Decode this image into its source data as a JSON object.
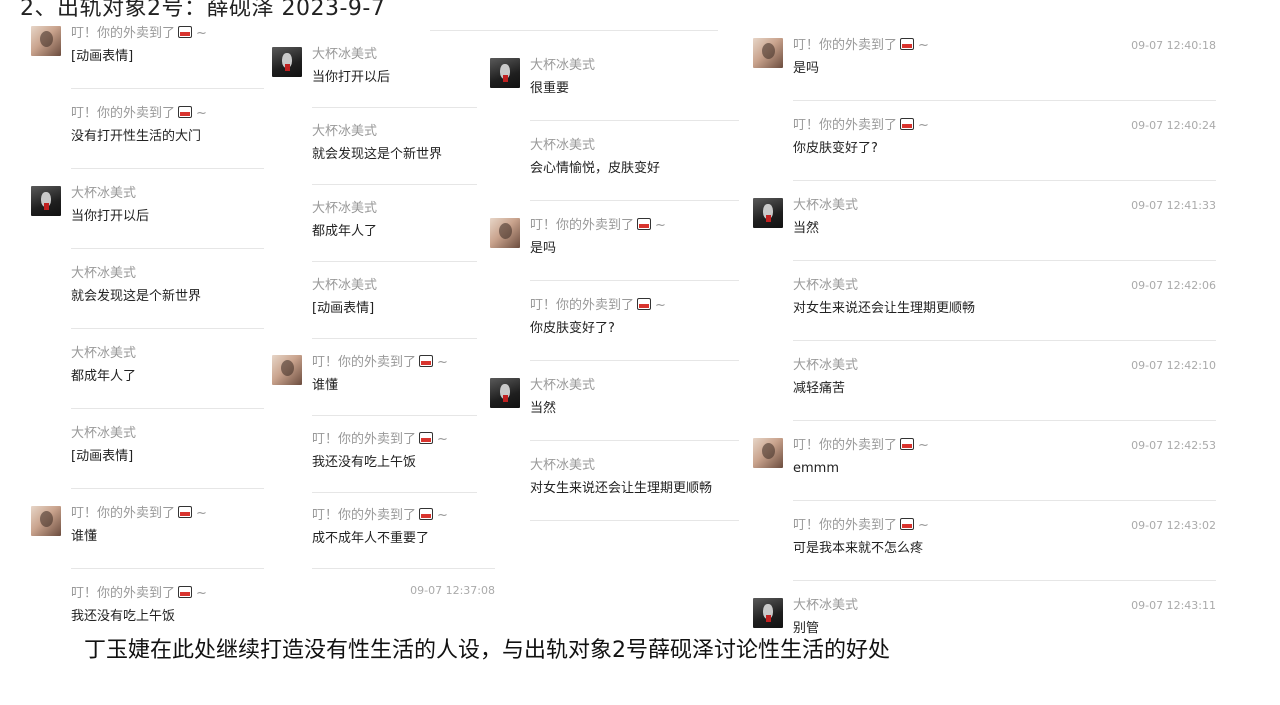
{
  "header": {
    "title": "2、出轨对象2号：薛砚泽 2023-9-7"
  },
  "footer": {
    "caption": "丁玉婕在此处继续打造没有性生活的人设，与出轨对象2号薛砚泽讨论性生活的好处"
  },
  "senders": {
    "woman": "叮！你的外卖到了",
    "man": "大杯冰美式"
  },
  "icons": {
    "takeout_box": "takeout-box-icon",
    "suffix": "~"
  },
  "columns": [
    {
      "messages": [
        {
          "sender": "叮！你的外卖到了",
          "text": "[动画表情]"
        },
        {
          "sender": "叮！你的外卖到了",
          "text": "没有打开性生活的大门"
        },
        {
          "sender": "大杯冰美式",
          "text": "当你打开以后"
        },
        {
          "sender": "大杯冰美式",
          "text": "就会发现这是个新世界"
        },
        {
          "sender": "大杯冰美式",
          "text": "都成年人了"
        },
        {
          "sender": "大杯冰美式",
          "text": "[动画表情]"
        },
        {
          "sender": "叮！你的外卖到了",
          "text": "谁懂"
        },
        {
          "sender": "叮！你的外卖到了",
          "text": "我还没有吃上午饭"
        }
      ]
    },
    {
      "messages": [
        {
          "sender": "大杯冰美式",
          "text": "当你打开以后"
        },
        {
          "sender": "大杯冰美式",
          "text": "就会发现这是个新世界"
        },
        {
          "sender": "大杯冰美式",
          "text": "都成年人了"
        },
        {
          "sender": "大杯冰美式",
          "text": "[动画表情]"
        },
        {
          "sender": "叮！你的外卖到了",
          "text": "谁懂"
        },
        {
          "sender": "叮！你的外卖到了",
          "text": "我还没有吃上午饭"
        },
        {
          "sender": "叮！你的外卖到了",
          "text": "成不成年人不重要了"
        }
      ],
      "trailing_time": "09-07 12:37:08"
    },
    {
      "messages": [
        {
          "sender": "大杯冰美式",
          "text": "很重要"
        },
        {
          "sender": "大杯冰美式",
          "text": "会心情愉悦，皮肤变好"
        },
        {
          "sender": "叮！你的外卖到了",
          "text": "是吗"
        },
        {
          "sender": "叮！你的外卖到了",
          "text": "你皮肤变好了?"
        },
        {
          "sender": "大杯冰美式",
          "text": "当然"
        },
        {
          "sender": "大杯冰美式",
          "text": "对女生来说还会让生理期更顺畅"
        }
      ]
    },
    {
      "messages": [
        {
          "sender": "叮！你的外卖到了",
          "text": "是吗",
          "time": "09-07 12:40:18"
        },
        {
          "sender": "叮！你的外卖到了",
          "text": "你皮肤变好了?",
          "time": "09-07 12:40:24"
        },
        {
          "sender": "大杯冰美式",
          "text": "当然",
          "time": "09-07 12:41:33"
        },
        {
          "sender": "大杯冰美式",
          "text": "对女生来说还会让生理期更顺畅",
          "time": "09-07 12:42:06"
        },
        {
          "sender": "大杯冰美式",
          "text": "减轻痛苦",
          "time": "09-07 12:42:10"
        },
        {
          "sender": "叮！你的外卖到了",
          "text": "emmm",
          "time": "09-07 12:42:53"
        },
        {
          "sender": "叮！你的外卖到了",
          "text": "可是我本来就不怎么疼",
          "time": "09-07 12:43:02"
        },
        {
          "sender": "大杯冰美式",
          "text": "别管",
          "time": "09-07 12:43:11"
        }
      ]
    }
  ]
}
